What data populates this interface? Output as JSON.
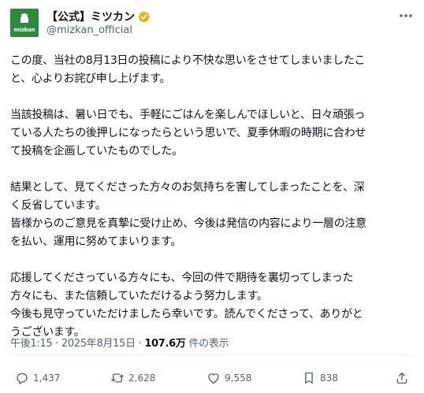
{
  "author": {
    "avatar_text": "mizkan",
    "display_name": "【公式】ミツカン",
    "handle": "@mizkan_official",
    "verified": true
  },
  "tweet": {
    "paragraphs": [
      {
        "lines": [
          "この度、当社の8月13日の投稿により不快な思いをさせてしまいましたこ",
          "と、心よりお詫び申し上げます。"
        ]
      },
      {
        "lines": [
          "当該投稿は、暑い日でも、手軽にごはんを楽しんでほしいと、日々頑張っ",
          "ている人たちの後押しになったらという思いで、夏季休暇の時期に合わせ",
          "て投稿を企画していたものでした。"
        ]
      },
      {
        "lines": [
          "結果として、見てくださった方々のお気持ちを害してしまったことを、深",
          "く反省しています。",
          "皆様からのご意見を真摯に受け止め、今後は発信の内容により一層の注意",
          "を払い、運用に努めてまいります。"
        ]
      },
      {
        "lines": [
          "応援してくださっている方々にも、今回の件で期待を裏切ってしまった",
          "方々にも、また信頼していただけるよう努力します。",
          "今後も見守っていただけましたら幸いです。読んでくださって、ありがと",
          "うございます。"
        ]
      }
    ]
  },
  "meta": {
    "time": "午後1:15",
    "separator": " · ",
    "date": "2025年8月15日",
    "views_count": "107.6万",
    "views_label": " 件の表示"
  },
  "actions": {
    "reply_count": "1,437",
    "repost_count": "2,628",
    "like_count": "9,558",
    "bookmark_count": "838"
  },
  "colors": {
    "avatar_bg": "#2a8a3e",
    "verified_gold": "#e2b719",
    "secondary_text": "#536471"
  },
  "icons": [
    "more-icon",
    "verified-badge-icon",
    "reply-icon",
    "repost-icon",
    "like-icon",
    "bookmark-icon",
    "share-icon"
  ]
}
